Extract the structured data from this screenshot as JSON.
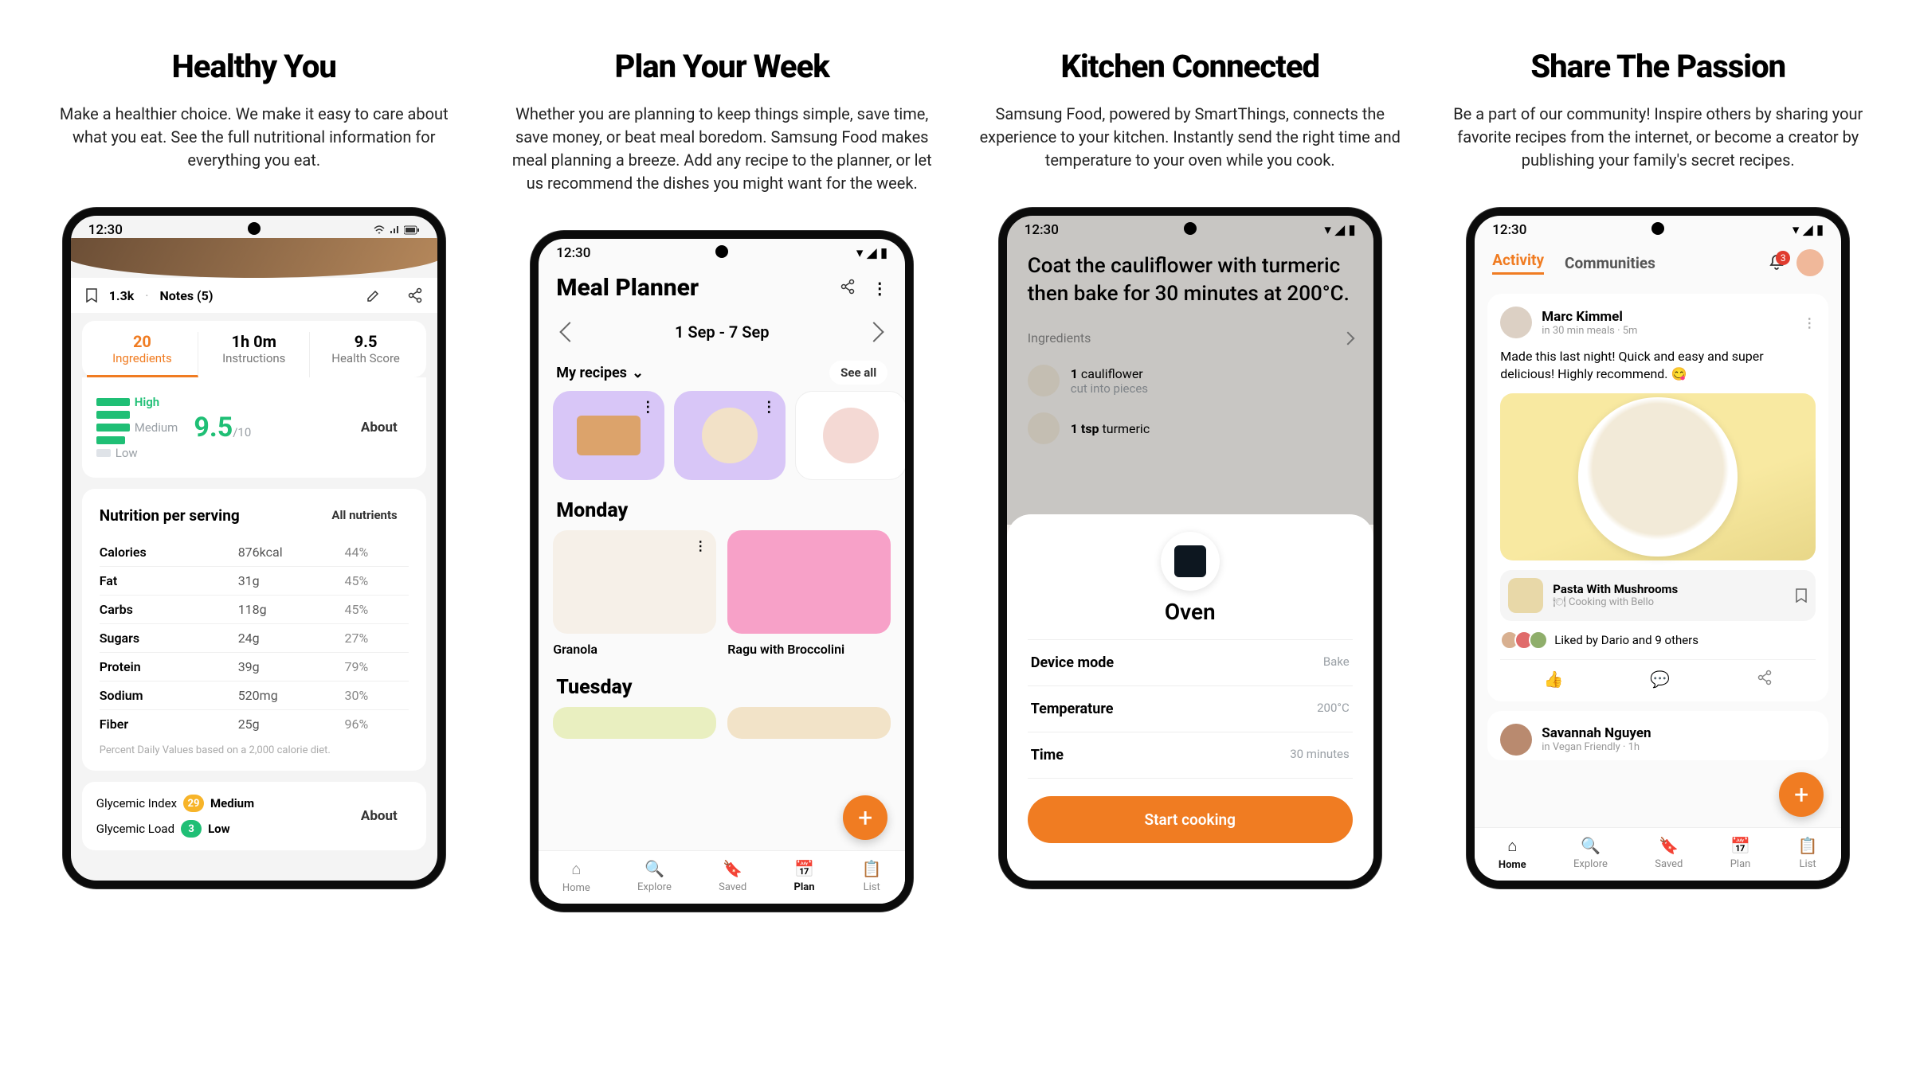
{
  "statusTime": "12:30",
  "columns": [
    {
      "headline": "Healthy You",
      "sub": "Make a healthier choice. We make it easy to care about what you eat. See the full nutritional information for everything you eat."
    },
    {
      "headline": "Plan Your Week",
      "sub": "Whether you are planning to keep things simple, save time, save money, or beat meal boredom. Samsung Food makes meal planning a breeze. Add any recipe to the planner, or let us recommend the dishes you might want for the week."
    },
    {
      "headline": "Kitchen Connected",
      "sub": "Samsung Food, powered by SmartThings, connects the experience to your kitchen. Instantly send the right time and temperature to your oven while you cook."
    },
    {
      "headline": "Share The Passion",
      "sub": "Be a part of our community! Inspire others by sharing your favorite recipes from the internet, or become a creator by publishing your family's secret recipes."
    }
  ],
  "p1": {
    "saves": "1.3k",
    "notes": "Notes (5)",
    "tabs": [
      {
        "num": "20",
        "lbl": "Ingredients"
      },
      {
        "num": "1h 0m",
        "lbl": "Instructions"
      },
      {
        "num": "9.5",
        "lbl": "Health Score"
      }
    ],
    "levels": {
      "high": "High",
      "medium": "Medium",
      "low": "Low"
    },
    "score": "9.5",
    "scoreMax": "/10",
    "about": "About",
    "nutritionTitle": "Nutrition per serving",
    "allNutrients": "All nutrients",
    "rows": [
      {
        "l": "Calories",
        "v": "876kcal",
        "p": "44%"
      },
      {
        "l": "Fat",
        "v": "31g",
        "p": "45%"
      },
      {
        "l": "Carbs",
        "v": "118g",
        "p": "45%"
      },
      {
        "l": "Sugars",
        "v": "24g",
        "p": "27%"
      },
      {
        "l": "Protein",
        "v": "39g",
        "p": "79%"
      },
      {
        "l": "Sodium",
        "v": "520mg",
        "p": "30%"
      },
      {
        "l": "Fiber",
        "v": "25g",
        "p": "96%"
      }
    ],
    "dvNote": "Percent Daily Values based on a 2,000 calorie diet.",
    "glyIndex": {
      "label": "Glycemic Index",
      "val": "29",
      "level": "Medium",
      "color": "#f7b429"
    },
    "glyLoad": {
      "label": "Glycemic Load",
      "val": "3",
      "level": "Low",
      "color": "#1fbf75"
    }
  },
  "p2": {
    "title": "Meal Planner",
    "range": "1 Sep - 7 Sep",
    "myRecipes": "My recipes",
    "seeAll": "See all",
    "days": [
      "Monday",
      "Tuesday"
    ],
    "meals": [
      {
        "name": "Granola"
      },
      {
        "name": "Ragu with Broccolini"
      }
    ],
    "nav": [
      "Home",
      "Explore",
      "Saved",
      "Plan",
      "List"
    ],
    "navActive": 3
  },
  "p3": {
    "instruction": "Coat the cauliflower with turmeric then bake for 30 minutes at 200°C.",
    "ingredientsLabel": "Ingredients",
    "ings": [
      {
        "qty": "1",
        "name": "cauliflower",
        "note": "cut into pieces"
      },
      {
        "qty": "1 tsp",
        "name": "turmeric",
        "note": ""
      }
    ],
    "device": "Oven",
    "params": [
      {
        "l": "Device mode",
        "v": "Bake"
      },
      {
        "l": "Temperature",
        "v": "200°C"
      },
      {
        "l": "Time",
        "v": "30 minutes"
      }
    ],
    "cta": "Start cooking"
  },
  "p4": {
    "tabs": [
      "Activity",
      "Communities"
    ],
    "tabActive": 0,
    "notifCount": "3",
    "post": {
      "author": "Marc Kimmel",
      "meta": "in 30 min meals · 5m",
      "text": "Made this last night! Quick and easy and super delicious! Highly recommend. 😋",
      "recipeTitle": "Pasta With Mushrooms",
      "recipeBy": "🍽 Cooking with Bello",
      "likes": "Liked by Dario and 9 others"
    },
    "post2": {
      "author": "Savannah Nguyen",
      "meta": "in Vegan Friendly · 1h"
    },
    "nav": [
      "Home",
      "Explore",
      "Saved",
      "Plan",
      "List"
    ],
    "navActive": 0
  }
}
